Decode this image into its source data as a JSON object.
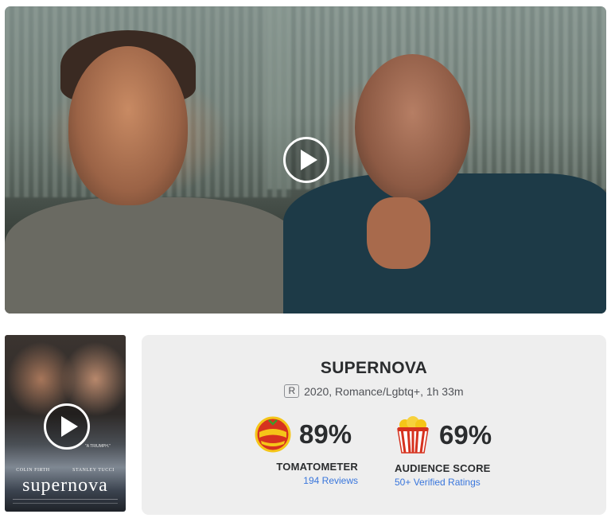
{
  "hero": {
    "play_icon": "play-circle-icon"
  },
  "poster": {
    "quote": "\"A TRIUMPH.\"",
    "actor_left": "COLIN FIRTH",
    "actor_right": "STANLEY TUCCI",
    "title": "supernova",
    "play_icon": "play-circle-icon"
  },
  "movie": {
    "title": "SUPERNOVA",
    "rating": "R",
    "info": "2020, Romance/Lgbtq+, 1h 33m"
  },
  "tomatometer": {
    "badge_icon": "certified-fresh-icon",
    "score": "89%",
    "label": "TOMATOMETER",
    "reviews": "194 Reviews"
  },
  "audience": {
    "badge_icon": "popcorn-bucket-icon",
    "score": "69%",
    "label": "AUDIENCE SCORE",
    "ratings": "50+ Verified Ratings"
  },
  "colors": {
    "link": "#3976dc",
    "text": "#2a2c2e",
    "card_bg": "#eeeeee",
    "tomato_red": "#d6321f",
    "fresh_yellow": "#f5c518"
  }
}
